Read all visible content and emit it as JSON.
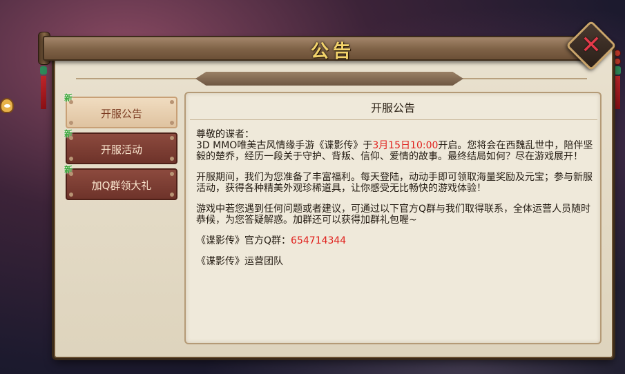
{
  "dialog": {
    "title": "公告",
    "close_label": "✕"
  },
  "sidebar": {
    "new_badge": "新",
    "items": [
      {
        "label": "开服公告",
        "active": true
      },
      {
        "label": "开服活动",
        "active": false
      },
      {
        "label": "加Q群领大礼",
        "active": false
      }
    ]
  },
  "content": {
    "title": "开服公告",
    "greeting": "尊敬的谍者：",
    "p1_prefix": "3D MMO唯美古风情缘手游《谍影传》于",
    "p1_date": "3月15日10:00",
    "p1_suffix": "开启。您将会在西魏乱世中，陪伴坚毅的楚乔，经历一段关于守护、背叛、信仰、爱情的故事。最终结局如何？尽在游戏展开！",
    "p2": "开服期间，我们为您准备了丰富福利。每天登陆，动动手即可领取海量奖励及元宝；参与新服活动，获得各种精美外观珍稀道具，让你感受无比畅快的游戏体验！",
    "p3": "游戏中若您遇到任何问题或者建议，可通过以下官方Q群与我们取得联系，全体运营人员随时恭候，为您答疑解惑。加群还可以获得加群礼包喔~",
    "qq_label": "《谍影传》官方Q群：",
    "qq_number": "654714344",
    "signature": "《谍影传》运营团队"
  },
  "colors": {
    "accent_red": "#e0201c",
    "active_tab": "#dfc3a0",
    "inactive_tab": "#6e332a",
    "new_badge": "#3aa83a",
    "title_gold": "#f3d36b"
  }
}
